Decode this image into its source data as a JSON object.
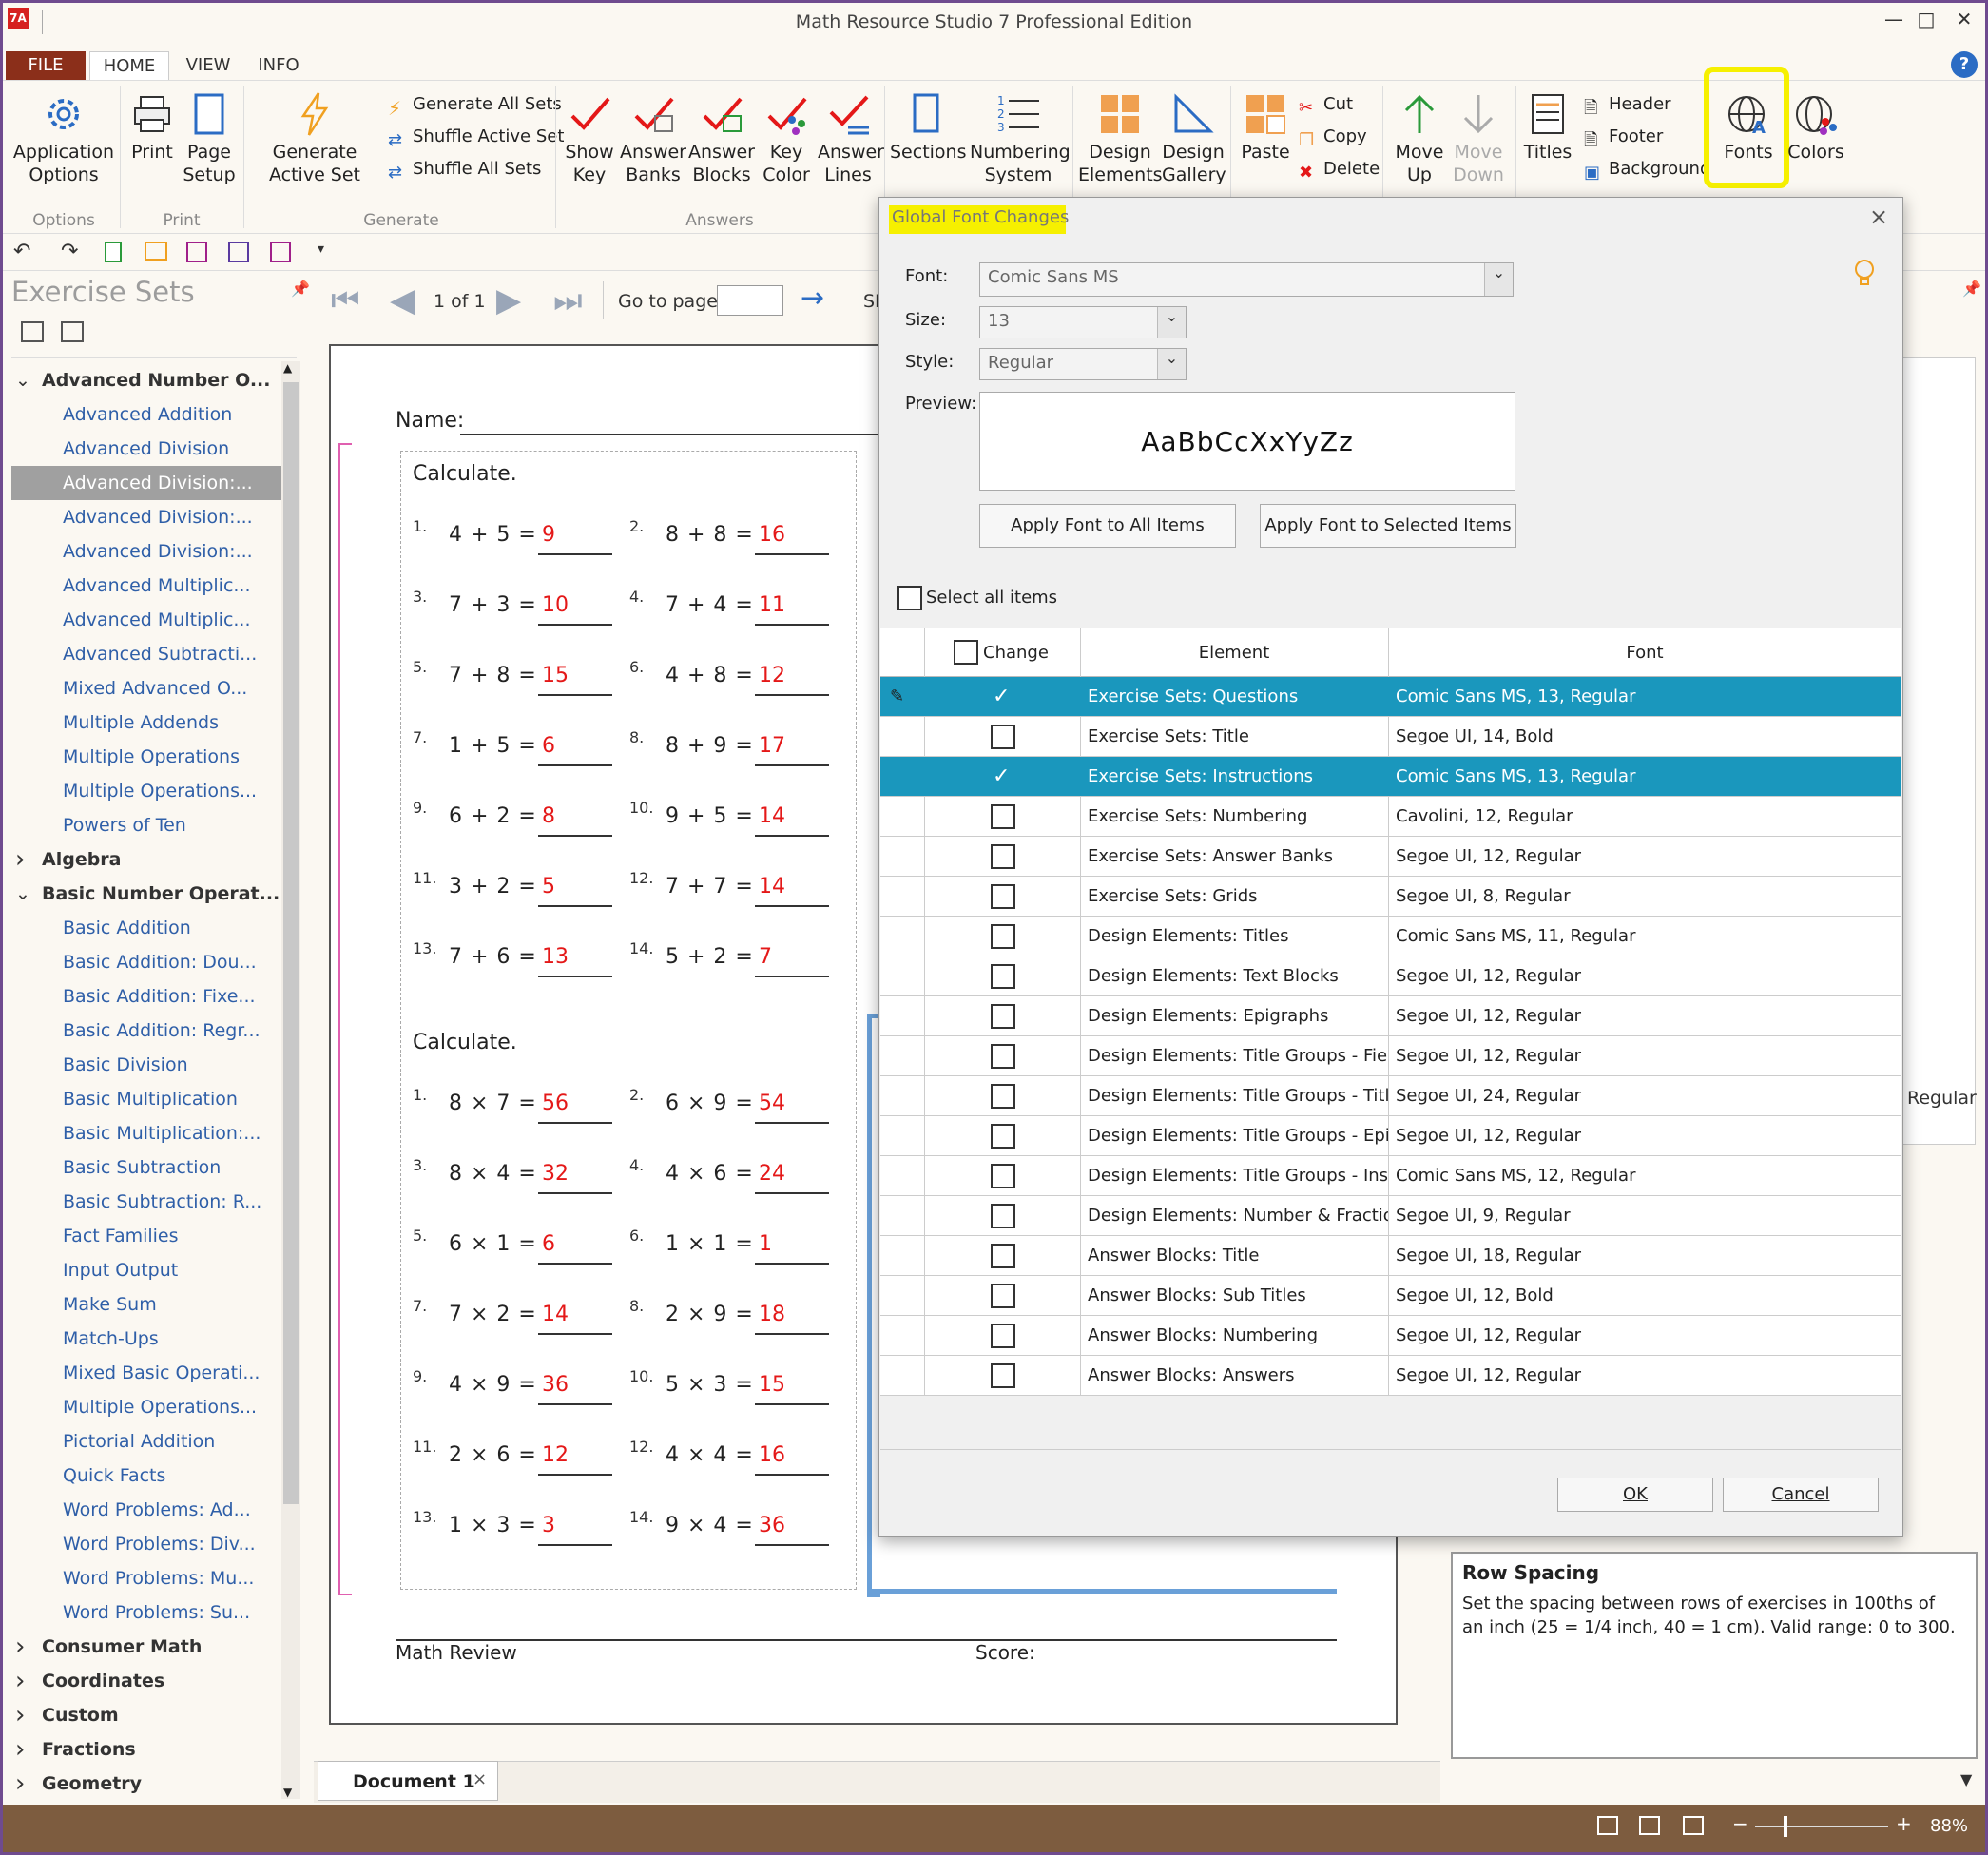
{
  "window": {
    "title": "Math Resource Studio 7 Professional Edition",
    "app_badge": "7A"
  },
  "menu_tabs": [
    "FILE",
    "HOME",
    "VIEW",
    "INFO"
  ],
  "ribbon": {
    "options": {
      "app_options": "Application Options",
      "group": "Options"
    },
    "print": {
      "print": "Print",
      "page_setup": "Page Setup",
      "group": "Print"
    },
    "generate": {
      "active": "Generate Active Set",
      "all_sets": "Generate All Sets",
      "shuffle_active": "Shuffle Active Set",
      "shuffle_all": "Shuffle All Sets",
      "group": "Generate"
    },
    "answers": {
      "show_key": "Show Key",
      "answer_banks": "Answer Banks",
      "answer_blocks": "Answer Blocks",
      "key_color": "Key Color",
      "answer_lines": "Answer Lines",
      "group": "Answers"
    },
    "sections": "Sections",
    "numbering": "Numbering System",
    "design_elements": "Design Elements",
    "design_gallery": "Design Gallery",
    "paste": "Paste",
    "cut": "Cut",
    "copy": "Copy",
    "delete": "Delete",
    "move_up": "Move Up",
    "move_down": "Move Down",
    "titles": "Titles",
    "header": "Header",
    "footer": "Footer",
    "background": "Background",
    "fonts": "Fonts",
    "colors": "Colors",
    "highlight_color": "#f6f000"
  },
  "left_panel": {
    "title": "Exercise Sets",
    "tree": [
      {
        "label": "Advanced Number O...",
        "type": "cat",
        "expanded": true
      },
      {
        "label": "Advanced Addition",
        "type": "leaf"
      },
      {
        "label": "Advanced Division",
        "type": "leaf"
      },
      {
        "label": "Advanced Division:...",
        "type": "leaf",
        "selected": true
      },
      {
        "label": "Advanced Division:...",
        "type": "leaf"
      },
      {
        "label": "Advanced Division:...",
        "type": "leaf"
      },
      {
        "label": "Advanced Multiplic...",
        "type": "leaf"
      },
      {
        "label": "Advanced Multiplic...",
        "type": "leaf"
      },
      {
        "label": "Advanced Subtracti...",
        "type": "leaf"
      },
      {
        "label": "Mixed Advanced O...",
        "type": "leaf"
      },
      {
        "label": "Multiple Addends",
        "type": "leaf"
      },
      {
        "label": "Multiple Operations",
        "type": "leaf"
      },
      {
        "label": "Multiple Operations...",
        "type": "leaf"
      },
      {
        "label": "Powers of Ten",
        "type": "leaf"
      },
      {
        "label": "Algebra",
        "type": "cat",
        "expanded": false
      },
      {
        "label": "Basic Number Operat...",
        "type": "cat",
        "expanded": true
      },
      {
        "label": "Basic Addition",
        "type": "leaf"
      },
      {
        "label": "Basic Addition: Dou...",
        "type": "leaf"
      },
      {
        "label": "Basic Addition: Fixe...",
        "type": "leaf"
      },
      {
        "label": "Basic Addition: Regr...",
        "type": "leaf"
      },
      {
        "label": "Basic Division",
        "type": "leaf"
      },
      {
        "label": "Basic Multiplication",
        "type": "leaf"
      },
      {
        "label": "Basic Multiplication:...",
        "type": "leaf"
      },
      {
        "label": "Basic Subtraction",
        "type": "leaf"
      },
      {
        "label": "Basic Subtraction: R...",
        "type": "leaf"
      },
      {
        "label": "Fact Families",
        "type": "leaf"
      },
      {
        "label": "Input Output",
        "type": "leaf"
      },
      {
        "label": "Make Sum",
        "type": "leaf"
      },
      {
        "label": "Match-Ups",
        "type": "leaf"
      },
      {
        "label": "Mixed Basic Operati...",
        "type": "leaf"
      },
      {
        "label": "Multiple Operations...",
        "type": "leaf"
      },
      {
        "label": "Pictorial Addition",
        "type": "leaf"
      },
      {
        "label": "Quick Facts",
        "type": "leaf"
      },
      {
        "label": "Word Problems: Ad...",
        "type": "leaf"
      },
      {
        "label": "Word Problems: Div...",
        "type": "leaf"
      },
      {
        "label": "Word Problems: Mu...",
        "type": "leaf"
      },
      {
        "label": "Word Problems: Su...",
        "type": "leaf"
      },
      {
        "label": "Consumer Math",
        "type": "cat",
        "expanded": false
      },
      {
        "label": "Coordinates",
        "type": "cat",
        "expanded": false
      },
      {
        "label": "Custom",
        "type": "cat",
        "expanded": false
      },
      {
        "label": "Fractions",
        "type": "cat",
        "expanded": false
      },
      {
        "label": "Geometry",
        "type": "cat",
        "expanded": false
      }
    ]
  },
  "nav": {
    "page_indicator": "1 of 1",
    "goto_label": "Go to page:",
    "goto_value": "",
    "cut_off_label": "SN"
  },
  "worksheet": {
    "name_label": "Name:",
    "footer_left": "Math Review",
    "footer_right": "Score:",
    "sections": [
      {
        "heading": "Calculate.",
        "op": "+",
        "problems": [
          {
            "n": "1.",
            "a": "4",
            "b": "5",
            "ans": "9"
          },
          {
            "n": "2.",
            "a": "8",
            "b": "8",
            "ans": "16"
          },
          {
            "n": "3.",
            "a": "7",
            "b": "3",
            "ans": "10"
          },
          {
            "n": "4.",
            "a": "7",
            "b": "4",
            "ans": "11"
          },
          {
            "n": "5.",
            "a": "7",
            "b": "8",
            "ans": "15"
          },
          {
            "n": "6.",
            "a": "4",
            "b": "8",
            "ans": "12"
          },
          {
            "n": "7.",
            "a": "1",
            "b": "5",
            "ans": "6"
          },
          {
            "n": "8.",
            "a": "8",
            "b": "9",
            "ans": "17"
          },
          {
            "n": "9.",
            "a": "6",
            "b": "2",
            "ans": "8"
          },
          {
            "n": "10.",
            "a": "9",
            "b": "5",
            "ans": "14"
          },
          {
            "n": "11.",
            "a": "3",
            "b": "2",
            "ans": "5"
          },
          {
            "n": "12.",
            "a": "7",
            "b": "7",
            "ans": "14"
          },
          {
            "n": "13.",
            "a": "7",
            "b": "6",
            "ans": "13"
          },
          {
            "n": "14.",
            "a": "5",
            "b": "2",
            "ans": "7"
          }
        ]
      },
      {
        "heading": "Calculate.",
        "op": "×",
        "problems": [
          {
            "n": "1.",
            "a": "8",
            "b": "7",
            "ans": "56"
          },
          {
            "n": "2.",
            "a": "6",
            "b": "9",
            "ans": "54"
          },
          {
            "n": "3.",
            "a": "8",
            "b": "4",
            "ans": "32"
          },
          {
            "n": "4.",
            "a": "4",
            "b": "6",
            "ans": "24"
          },
          {
            "n": "5.",
            "a": "6",
            "b": "1",
            "ans": "6"
          },
          {
            "n": "6.",
            "a": "1",
            "b": "1",
            "ans": "1"
          },
          {
            "n": "7.",
            "a": "7",
            "b": "2",
            "ans": "14"
          },
          {
            "n": "8.",
            "a": "2",
            "b": "9",
            "ans": "18"
          },
          {
            "n": "9.",
            "a": "4",
            "b": "9",
            "ans": "36"
          },
          {
            "n": "10.",
            "a": "5",
            "b": "3",
            "ans": "15"
          },
          {
            "n": "11.",
            "a": "2",
            "b": "6",
            "ans": "12"
          },
          {
            "n": "12.",
            "a": "4",
            "b": "4",
            "ans": "16"
          },
          {
            "n": "13.",
            "a": "1",
            "b": "3",
            "ans": "3"
          },
          {
            "n": "14.",
            "a": "9",
            "b": "4",
            "ans": "36"
          }
        ]
      }
    ]
  },
  "doc_tab": "Document 1",
  "dialog": {
    "title": "Global Font Changes",
    "font_label": "Font:",
    "font_value": "Comic Sans MS",
    "size_label": "Size:",
    "size_value": "13",
    "style_label": "Style:",
    "style_value": "Regular",
    "preview_label": "Preview:",
    "preview_text": "AaBbCcXxYyZz",
    "apply_all": "Apply Font to All Items",
    "apply_selected": "Apply Font to Selected Items",
    "select_all": "Select all items",
    "col_change": "Change",
    "col_element": "Element",
    "col_font": "Font",
    "rows": [
      {
        "element": "Exercise Sets: Questions",
        "font": "Comic Sans MS, 13, Regular",
        "checked": true,
        "selected": true,
        "editing": true
      },
      {
        "element": "Exercise Sets: Title",
        "font": "Segoe UI, 14, Bold",
        "checked": false
      },
      {
        "element": "Exercise Sets: Instructions",
        "font": "Comic Sans MS, 13, Regular",
        "checked": true,
        "selected": true
      },
      {
        "element": "Exercise Sets: Numbering",
        "font": "Cavolini, 12, Regular",
        "checked": false
      },
      {
        "element": "Exercise Sets: Answer Banks",
        "font": "Segoe UI, 12, Regular",
        "checked": false
      },
      {
        "element": "Exercise Sets: Grids",
        "font": "Segoe UI, 8, Regular",
        "checked": false
      },
      {
        "element": "Design Elements: Titles",
        "font": "Comic Sans MS, 11, Regular",
        "checked": false
      },
      {
        "element": "Design Elements: Text Blocks",
        "font": "Segoe UI, 12, Regular",
        "checked": false
      },
      {
        "element": "Design Elements: Epigraphs",
        "font": "Segoe UI, 12, Regular",
        "checked": false
      },
      {
        "element": "Design Elements: Title Groups - Fields",
        "font": "Segoe UI, 12, Regular",
        "checked": false
      },
      {
        "element": "Design Elements: Title Groups - Title",
        "font": "Segoe UI, 24, Regular",
        "checked": false
      },
      {
        "element": "Design Elements: Title Groups - Epig...",
        "font": "Segoe UI, 12, Regular",
        "checked": false
      },
      {
        "element": "Design Elements: Title Groups - Instr...",
        "font": "Comic Sans MS, 12, Regular",
        "checked": false
      },
      {
        "element": "Design Elements: Number & Fractio...",
        "font": "Segoe UI, 9, Regular",
        "checked": false
      },
      {
        "element": "Answer Blocks: Title",
        "font": "Segoe UI, 18, Regular",
        "checked": false
      },
      {
        "element": "Answer Blocks: Sub Titles",
        "font": "Segoe UI, 12, Bold",
        "checked": false
      },
      {
        "element": "Answer Blocks: Numbering",
        "font": "Segoe UI, 12, Regular",
        "checked": false
      },
      {
        "element": "Answer Blocks: Answers",
        "font": "Segoe UI, 12, Regular",
        "checked": false
      }
    ],
    "ok": "OK",
    "cancel": "Cancel"
  },
  "right_pane": {
    "regular_peek": "Regular",
    "help_title": "Row Spacing",
    "help_text": "Set the spacing between rows of exercises in 100ths of an inch (25 = 1/4 inch, 40 = 1 cm). Valid range: 0 to 300."
  },
  "status": {
    "zoom": "88%"
  },
  "colors": {
    "accent": "#1a97bd",
    "answer_red": "#e41818",
    "file_tab": "#8b2f1a",
    "link_blue": "#2f5fa8",
    "status_bar": "#7d5c3f"
  }
}
